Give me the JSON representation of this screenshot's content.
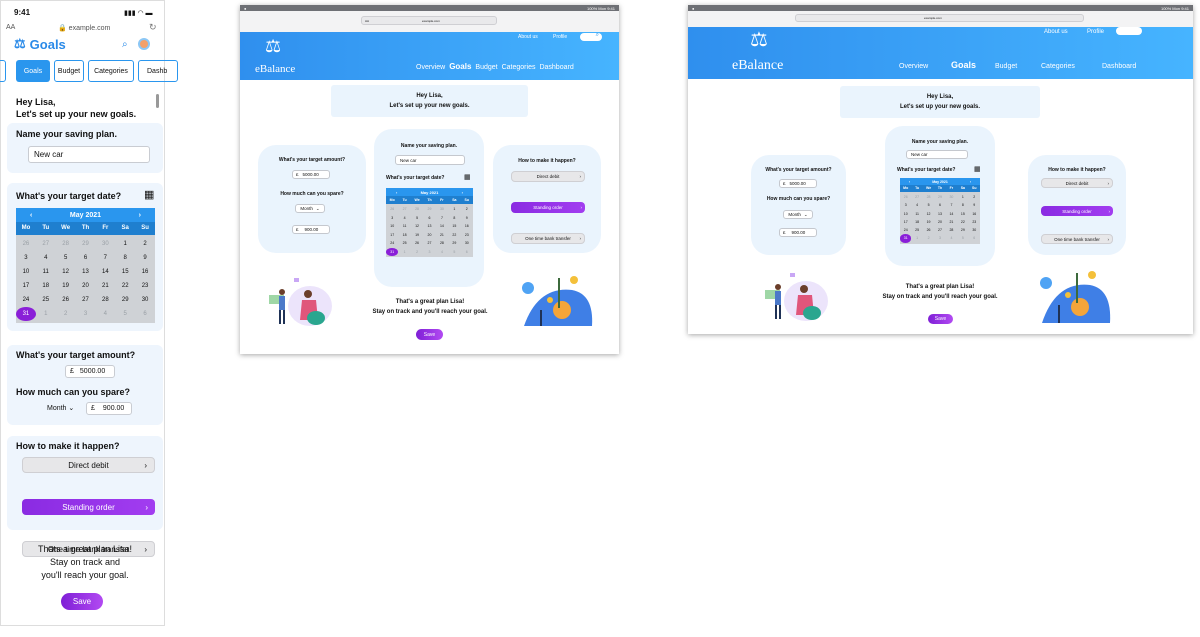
{
  "phone": {
    "time": "9:41",
    "status_icons": "signal-wifi-battery",
    "text_size_label": "AA",
    "url": "example.com",
    "logo_text": "Goals",
    "tabs": [
      "Goals",
      "Budget",
      "Categories",
      "Dashb"
    ],
    "greeting_line1": "Hey Lisa,",
    "greeting_line2": "Let's set up your new goals.",
    "name_label": "Name your saving plan.",
    "name_value": "New car",
    "date_label": "What's your target date?",
    "amount_label": "What's your target amount?",
    "amount_currency": "£",
    "amount_value": "5000.00",
    "spare_label": "How much can you spare?",
    "spare_period": "Month",
    "spare_currency": "£",
    "spare_value": "900.00",
    "how_label": "How to make it happen?",
    "options": [
      "Direct debit",
      "Standing order",
      "One time bank transfer"
    ],
    "closing_line1": "Thats a great plan Lisa!",
    "closing_line2": "Stay on track and",
    "closing_line3": "you'll reach your goal.",
    "save_label": "Save"
  },
  "calendar": {
    "month": "May 2021",
    "weekdays": [
      "Mo",
      "Tu",
      "We",
      "Th",
      "Fr",
      "Sa",
      "Su"
    ],
    "days": [
      [
        "26",
        "o"
      ],
      [
        "27",
        "o"
      ],
      [
        "28",
        "o"
      ],
      [
        "29",
        "o"
      ],
      [
        "30",
        "o"
      ],
      [
        "1",
        ""
      ],
      [
        "2",
        ""
      ],
      [
        "3",
        ""
      ],
      [
        "4",
        ""
      ],
      [
        "5",
        ""
      ],
      [
        "6",
        ""
      ],
      [
        "7",
        ""
      ],
      [
        "8",
        ""
      ],
      [
        "9",
        ""
      ],
      [
        "10",
        ""
      ],
      [
        "11",
        ""
      ],
      [
        "12",
        ""
      ],
      [
        "13",
        ""
      ],
      [
        "14",
        ""
      ],
      [
        "15",
        ""
      ],
      [
        "16",
        ""
      ],
      [
        "17",
        ""
      ],
      [
        "18",
        ""
      ],
      [
        "19",
        ""
      ],
      [
        "20",
        ""
      ],
      [
        "21",
        ""
      ],
      [
        "22",
        ""
      ],
      [
        "23",
        ""
      ],
      [
        "24",
        ""
      ],
      [
        "25",
        ""
      ],
      [
        "26",
        ""
      ],
      [
        "27",
        ""
      ],
      [
        "28",
        ""
      ],
      [
        "29",
        ""
      ],
      [
        "30",
        ""
      ],
      [
        "31",
        "sel"
      ],
      [
        "1",
        "o"
      ],
      [
        "2",
        "o"
      ],
      [
        "3",
        "o"
      ],
      [
        "4",
        "o"
      ],
      [
        "5",
        "o"
      ],
      [
        "6",
        "o"
      ]
    ]
  },
  "tablet": {
    "status_right": "100%  Mon 9:41",
    "url_left": "AA",
    "url": "example.com",
    "brand": "eBalance",
    "top_links": [
      "About us",
      "Profile"
    ],
    "nav": [
      "Overview",
      "Goals",
      "Budget",
      "Categories",
      "Dashboard"
    ],
    "greeting_line1": "Hey Lisa,",
    "greeting_line2": "Let's set up your new goals.",
    "amount_label": "What's your target amount?",
    "amount_currency": "£",
    "amount_value": "5000.00",
    "spare_label": "How much can you spare?",
    "spare_period": "Month",
    "spare_currency": "£",
    "spare_value": "900.00",
    "name_label": "Name your saving plan.",
    "name_value": "New car",
    "date_label": "What's your target date?",
    "how_label": "How to make it happen?",
    "options": [
      "Direct debit",
      "Standing order",
      "One time bank transfer"
    ],
    "closing_line1": "That's a great plan Lisa!",
    "closing_line2": "Stay on track and you'll reach your goal.",
    "save_label": "Save"
  },
  "desktop": {
    "status_right": "100%  Mon 9:41",
    "url": "example.com",
    "brand": "eBalance",
    "top_links": [
      "About us",
      "Profile"
    ],
    "nav": [
      "Overview",
      "Goals",
      "Budget",
      "Categories",
      "Dashboard"
    ],
    "greeting_line1": "Hey Lisa,",
    "greeting_line2": "Let's set up your new goals.",
    "amount_label": "What's your target amount?",
    "amount_currency": "£",
    "amount_value": "5000.00",
    "spare_label": "How much can you spare?",
    "spare_period": "Month",
    "spare_currency": "£",
    "spare_value": "900.00",
    "name_label": "Name your saving plan.",
    "name_value": "New car",
    "date_label": "What's your target date?",
    "how_label": "How to make it happen?",
    "options": [
      "Direct debit",
      "Standing order",
      "One time bank transfer"
    ],
    "closing_line1": "That's a great plan Lisa!",
    "closing_line2": "Stay on track and you'll reach your goal.",
    "save_label": "Save"
  },
  "colors": {
    "accent_blue": "#2a96ee",
    "purple": "#8a2be2",
    "panel_bg": "#eaf4fd"
  }
}
